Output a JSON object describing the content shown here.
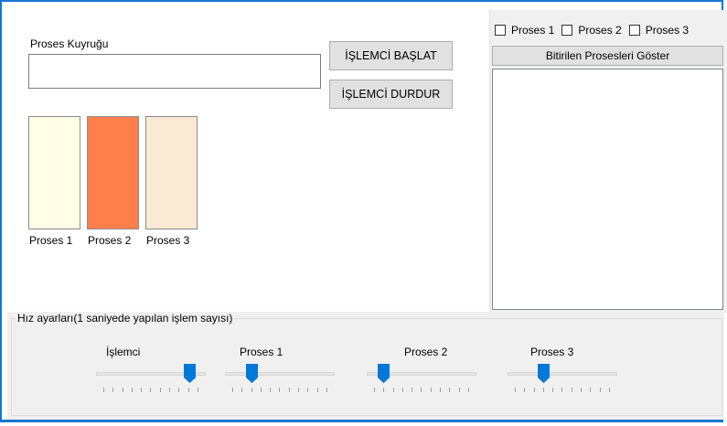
{
  "queue": {
    "label": "Proses Kuyruğu",
    "value": ""
  },
  "buttons": {
    "start": "İŞLEMCİ BAŞLAT",
    "stop": "İŞLEMCİ DURDUR"
  },
  "processes": [
    {
      "label": "Proses 1",
      "color": "#fffde6"
    },
    {
      "label": "Proses 2",
      "color": "#ff7f4c"
    },
    {
      "label": "Proses 3",
      "color": "#f9ead6"
    }
  ],
  "panel": {
    "checkboxes": [
      {
        "label": "Proses 1",
        "checked": false
      },
      {
        "label": "Proses 2",
        "checked": false
      },
      {
        "label": "Proses 3",
        "checked": false
      }
    ],
    "show_button": "Bitirilen Prosesleri Göster",
    "finished_list": []
  },
  "speed": {
    "title": "Hız ayarları(1 saniyede yapılan işlem sayısı)",
    "sliders": [
      {
        "label": "İşlemci",
        "value": 9,
        "max": 10
      },
      {
        "label": "Proses 1",
        "value": 2,
        "max": 10
      },
      {
        "label": "Proses 2",
        "value": 1,
        "max": 10
      },
      {
        "label": "Proses 3",
        "value": 3,
        "max": 10
      }
    ]
  },
  "colors": {
    "accent": "#0078d7",
    "frame": "#1a75d0"
  }
}
